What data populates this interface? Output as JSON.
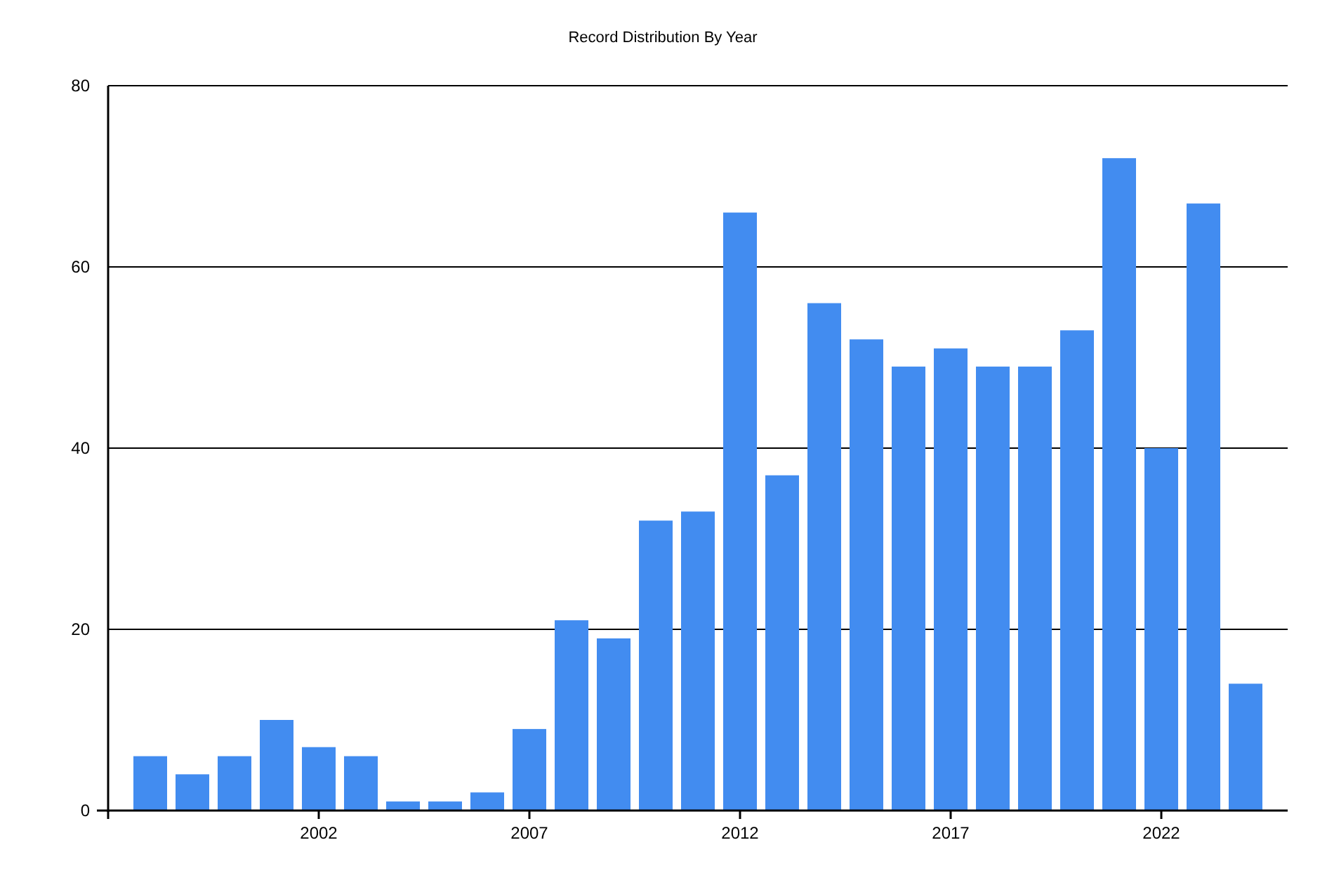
{
  "chart_data": {
    "type": "bar",
    "title": "Record Distribution By Year",
    "x": [
      1998,
      1999,
      2000,
      2001,
      2002,
      2003,
      2004,
      2005,
      2006,
      2007,
      2008,
      2009,
      2010,
      2011,
      2012,
      2013,
      2014,
      2015,
      2016,
      2017,
      2018,
      2019,
      2020,
      2021,
      2022,
      2023,
      2024
    ],
    "series": [
      {
        "color": "#428cf0",
        "values": [
          6,
          4,
          6,
          10,
          7,
          6,
          1,
          1,
          2,
          9,
          21,
          19,
          32,
          33,
          66,
          37,
          56,
          52,
          49,
          51,
          49,
          49,
          53,
          72,
          40,
          67,
          14
        ]
      }
    ],
    "grid": true,
    "xlim": [
      1997,
      2025
    ],
    "ylim": [
      0,
      80
    ],
    "xticks": [
      2002,
      2007,
      2012,
      2017,
      2022
    ],
    "yticks": [
      0,
      20,
      40,
      60,
      80
    ]
  }
}
